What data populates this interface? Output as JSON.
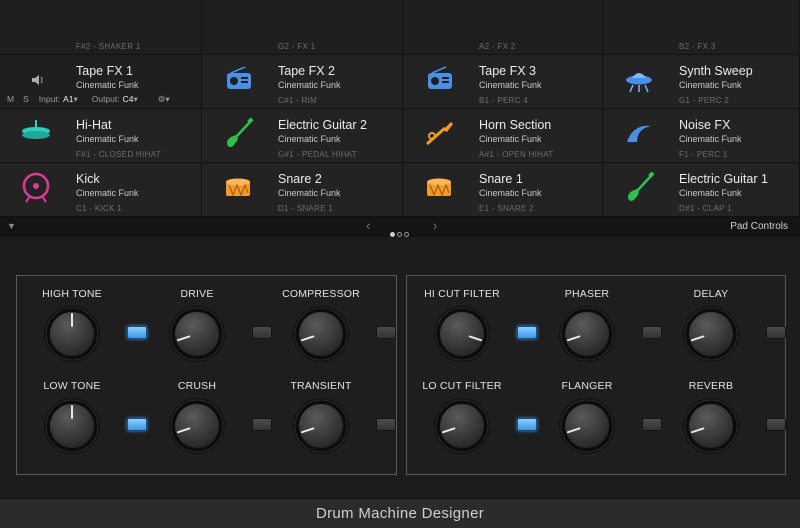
{
  "top_row": [
    "F#2 - SHAKER 1",
    "G2 - FX 1",
    "A2 - FX 2",
    "B2 - FX 3"
  ],
  "pads": [
    [
      {
        "name": "Tape FX 1",
        "kit": "Cinematic Funk",
        "note": "",
        "icon": "speaker-icon"
      },
      {
        "name": "Tape FX 2",
        "kit": "Cinematic Funk",
        "note": "C#1 - RIM",
        "icon": "radio-icon"
      },
      {
        "name": "Tape FX 3",
        "kit": "Cinematic Funk",
        "note": "B1 - PERC 4",
        "icon": "radio-icon"
      },
      {
        "name": "Synth Sweep",
        "kit": "Cinematic Funk",
        "note": "G1 - PERC 2",
        "icon": "ufo-icon"
      }
    ],
    [
      {
        "name": "Hi-Hat",
        "kit": "Cinematic Funk",
        "note": "F#1 - CLOSED HIHAT",
        "icon": "hihat-icon"
      },
      {
        "name": "Electric Guitar 2",
        "kit": "Cinematic Funk",
        "note": "G#1 - PEDAL HIHAT",
        "icon": "guitar-icon"
      },
      {
        "name": "Horn Section",
        "kit": "Cinematic Funk",
        "note": "A#1 - OPEN HIHAT",
        "icon": "trumpet-icon"
      },
      {
        "name": "Noise FX",
        "kit": "Cinematic Funk",
        "note": "F1 - PERC 1",
        "icon": "wave-icon"
      }
    ],
    [
      {
        "name": "Kick",
        "kit": "Cinematic Funk",
        "note": "C1 - KICK 1",
        "icon": "kick-drum-icon"
      },
      {
        "name": "Snare 2",
        "kit": "Cinematic Funk",
        "note": "D1 - SNARE 1",
        "icon": "snare-drum-icon"
      },
      {
        "name": "Snare 1",
        "kit": "Cinematic Funk",
        "note": "E1 - SNARE 2",
        "icon": "snare-drum-icon"
      },
      {
        "name": "Electric Guitar 1",
        "kit": "Cinematic Funk",
        "note": "D#1 - CLAP 1",
        "icon": "guitar-icon"
      }
    ]
  ],
  "selected_pad": {
    "m": "M",
    "s": "S",
    "input_label": "Input:",
    "input_value": "A1",
    "output_label": "Output:",
    "output_value": "C4",
    "count": "1"
  },
  "nav": {
    "prev": "‹",
    "next": "›",
    "pad_controls": "Pad Controls",
    "page_count": 3,
    "current_page": 0
  },
  "controls": {
    "left": [
      {
        "label": "HIGH TONE",
        "value": 0.5,
        "button_on": true
      },
      {
        "label": "DRIVE",
        "value": 0.1,
        "button_on": false
      },
      {
        "label": "COMPRESSOR",
        "value": 0.1,
        "button_on": false
      },
      {
        "label": "LOW TONE",
        "value": 0.5,
        "button_on": true
      },
      {
        "label": "CRUSH",
        "value": 0.1,
        "button_on": false
      },
      {
        "label": "TRANSIENT",
        "value": 0.1,
        "button_on": false
      }
    ],
    "right": [
      {
        "label": "HI CUT FILTER",
        "value": 0.9,
        "button_on": true
      },
      {
        "label": "PHASER",
        "value": 0.1,
        "button_on": false
      },
      {
        "label": "DELAY",
        "value": 0.1,
        "button_on": false
      },
      {
        "label": "LO CUT FILTER",
        "value": 0.1,
        "button_on": true
      },
      {
        "label": "FLANGER",
        "value": 0.1,
        "button_on": false
      },
      {
        "label": "REVERB",
        "value": 0.1,
        "button_on": false
      }
    ]
  },
  "footer_title": "Drum Machine Designer",
  "colors": {
    "accent_blue": "#3e97e6",
    "icon_blue": "#4a8fe8",
    "icon_green": "#2fc24a",
    "icon_orange": "#f39a2a",
    "icon_pink": "#e0389a",
    "icon_teal": "#2fd0c0"
  }
}
